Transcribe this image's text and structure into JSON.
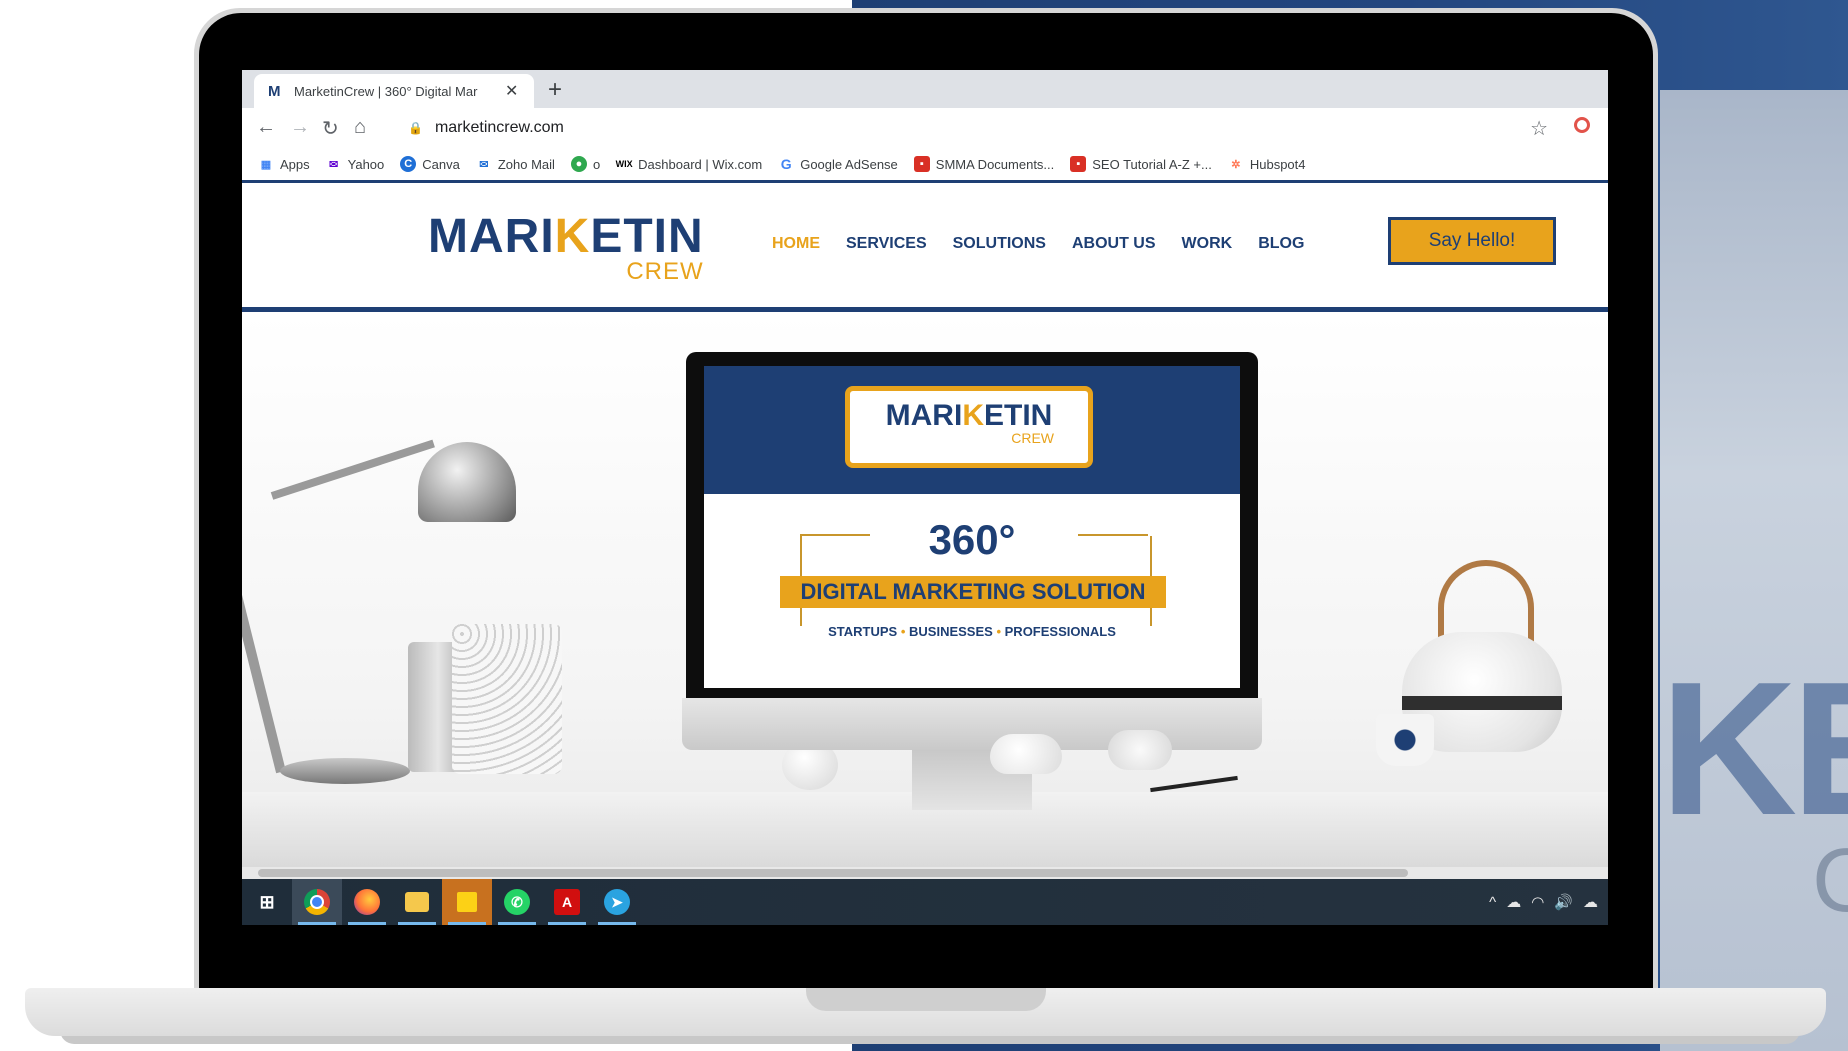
{
  "colors": {
    "brand_navy": "#1e3f74",
    "brand_gold": "#e8a31c",
    "taskbar": "#1f2d3a"
  },
  "browser": {
    "tab_title": "MarketinCrew | 360° Digital Mar",
    "tab_favicon": "M",
    "new_tab": "+",
    "close_tab": "✕",
    "url": "marketincrew.com",
    "bookmarks": [
      {
        "label": "Apps",
        "icon": "apps-grid-icon"
      },
      {
        "label": "Yahoo",
        "icon": "mail-icon"
      },
      {
        "label": "Canva",
        "icon": "canva-icon"
      },
      {
        "label": "Zoho Mail",
        "icon": "zoho-mail-icon"
      },
      {
        "label": "o",
        "icon": "green-circle-icon"
      },
      {
        "label": "Dashboard | Wix.com",
        "icon": "wix-icon"
      },
      {
        "label": "Google AdSense",
        "icon": "google-icon"
      },
      {
        "label": "SMMA Documents...",
        "icon": "document-icon"
      },
      {
        "label": "SEO Tutorial A-Z +...",
        "icon": "document-icon"
      },
      {
        "label": "Hubspot4",
        "icon": "hubspot-icon"
      }
    ]
  },
  "site": {
    "logo_main_a": "MARI",
    "logo_main_k": "K",
    "logo_main_b": "ETIN",
    "logo_sub": "CREW",
    "menu": [
      "HOME",
      "SERVICES",
      "SOLUTIONS",
      "ABOUT US",
      "WORK",
      "BLOG"
    ],
    "active_menu": "HOME",
    "cta": "Say Hello!"
  },
  "hero": {
    "badge_main_a": "MARI",
    "badge_main_k": "K",
    "badge_main_b": "ETIN",
    "badge_sub": "CREW",
    "degree": "360°",
    "headline": "DIGITAL MARKETING SOLUTION",
    "tag1": "STARTUPS",
    "tag2": "BUSINESSES",
    "tag3": "PROFESSIONALS",
    "tag_sep": "•"
  },
  "taskbar": {
    "apps": [
      "windows-start-icon",
      "chrome-icon",
      "firefox-icon",
      "file-explorer-icon",
      "sticky-notes-icon",
      "whatsapp-icon",
      "acrobat-icon",
      "telegram-icon"
    ],
    "tray": [
      "^",
      "☁",
      "wifi",
      "🔊",
      "☁"
    ]
  }
}
